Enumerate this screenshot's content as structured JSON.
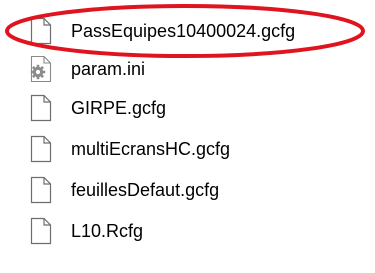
{
  "files": [
    {
      "name": "PassEquipes10400024.gcfg",
      "icon": "blank-file-icon"
    },
    {
      "name": "param.ini",
      "icon": "settings-file-icon"
    },
    {
      "name": "GIRPE.gcfg",
      "icon": "blank-file-icon"
    },
    {
      "name": "multiEcransHC.gcfg",
      "icon": "blank-file-icon"
    },
    {
      "name": "feuillesDefaut.gcfg",
      "icon": "blank-file-icon"
    },
    {
      "name": "L10.Rcfg",
      "icon": "blank-file-icon"
    }
  ],
  "highlight": {
    "color": "#e0141e",
    "target": "PassEquipes10400024.gcfg"
  }
}
